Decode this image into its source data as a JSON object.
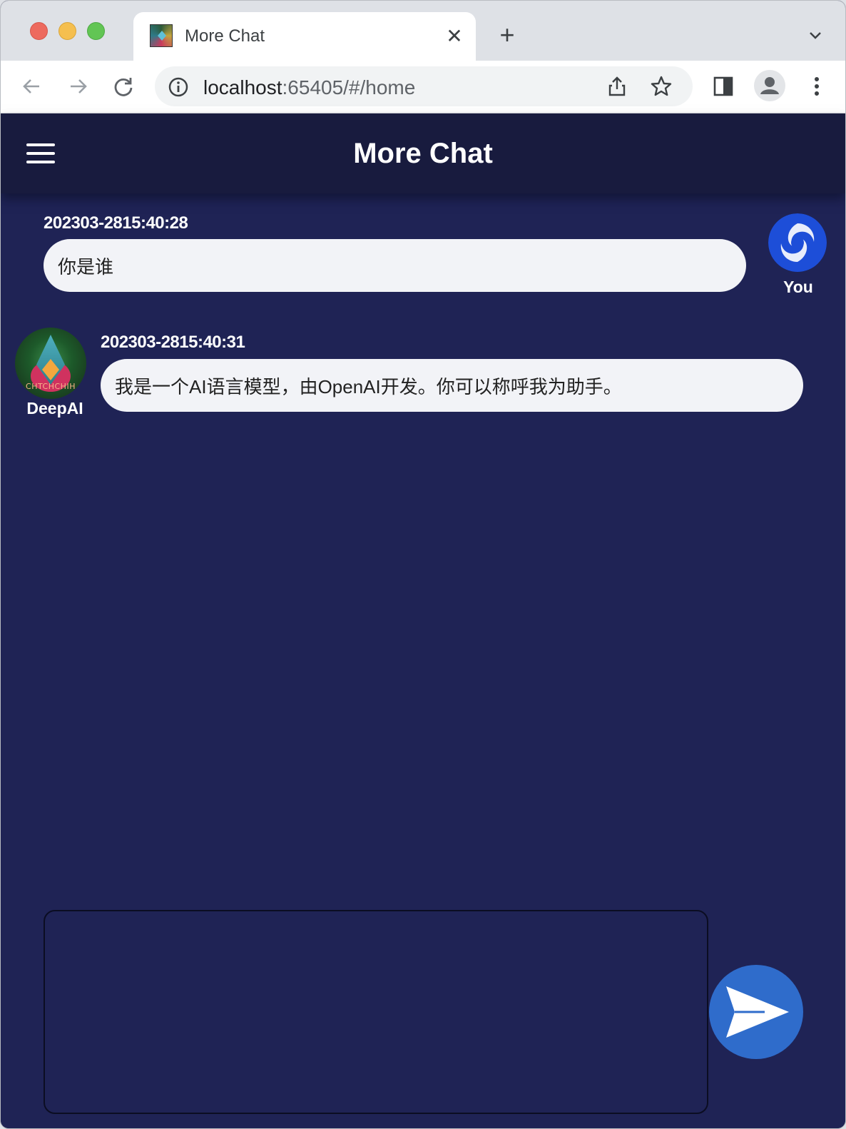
{
  "browser": {
    "tab_title": "More Chat",
    "url_host": "localhost",
    "url_rest": ":65405/#/home"
  },
  "app": {
    "title": "More Chat",
    "accent_color": "#2f6ccb",
    "background_color": "#1f2355"
  },
  "messages": [
    {
      "sender": "You",
      "timestamp": "202303-2815:40:28",
      "text": "你是谁",
      "side": "right"
    },
    {
      "sender": "DeepAI",
      "timestamp": "202303-2815:40:31",
      "text": "我是一个AI语言模型，由OpenAI开发。你可以称呼我为助手。",
      "side": "left",
      "avatar_text": "CHTCHCHIH"
    }
  ],
  "composer": {
    "value": ""
  }
}
